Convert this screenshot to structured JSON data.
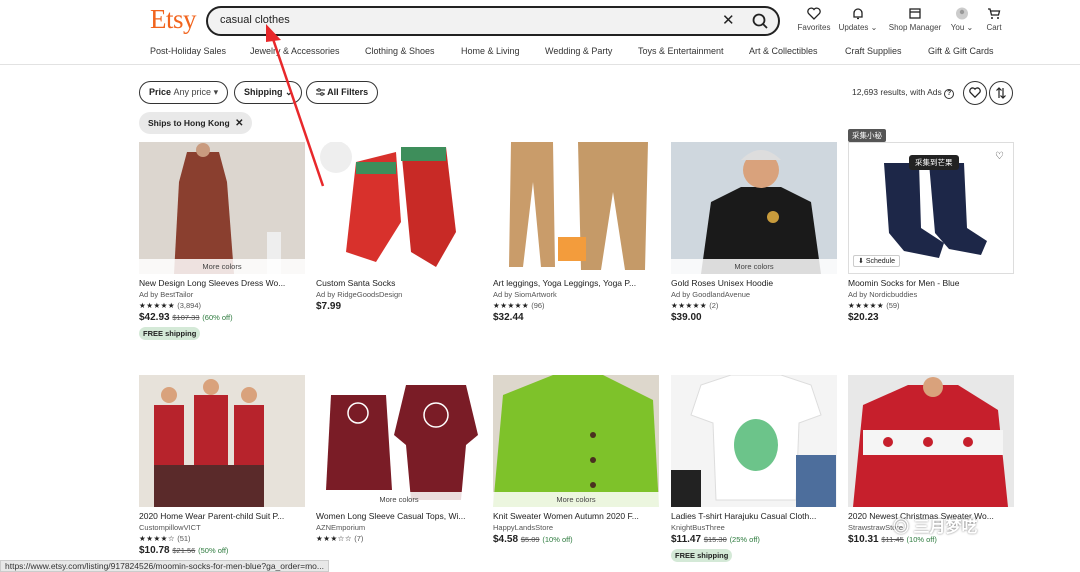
{
  "header": {
    "logo": "Etsy",
    "search_value": "casual clothes",
    "clear_glyph": "✕",
    "icons": [
      {
        "label": "Favorites",
        "icon": "heart-icon"
      },
      {
        "label": "Updates ⌄",
        "icon": "bell-icon"
      },
      {
        "label": "Shop Manager",
        "icon": "shop-icon"
      },
      {
        "label": "You ⌄",
        "icon": "avatar-icon"
      },
      {
        "label": "Cart",
        "icon": "cart-icon"
      }
    ]
  },
  "categories": [
    "Post-Holiday Sales",
    "Jewelry & Accessories",
    "Clothing & Shoes",
    "Home & Living",
    "Wedding & Party",
    "Toys & Entertainment",
    "Art & Collectibles",
    "Craft Supplies",
    "Gift & Gift Cards"
  ],
  "filters": {
    "price_label": "Price",
    "price_value": "Any price ▾",
    "shipping": "Shipping ⌄",
    "all_filters": "All Filters",
    "results": "12,693 results, with Ads",
    "chip": "Ships to Hong Kong"
  },
  "products": [
    {
      "title": "New Design Long Sleeves Dress Wo...",
      "ad": "Ad by BestTailor",
      "stars": "★★★★★",
      "reviews": "(3,894)",
      "price": "$42.93",
      "orig": "$107.33",
      "disc": "(60% off)",
      "ship": "FREE shipping",
      "colors": "More colors"
    },
    {
      "title": "Custom Santa Socks",
      "ad": "Ad by RidgeGoodsDesign",
      "stars": "",
      "reviews": "",
      "price": "$7.99",
      "orig": "",
      "disc": "",
      "ship": "",
      "colors": ""
    },
    {
      "title": "Art leggings, Yoga Leggings, Yoga P...",
      "ad": "Ad by SiomArtwork",
      "stars": "★★★★★",
      "reviews": "(96)",
      "price": "$32.44",
      "orig": "",
      "disc": "",
      "ship": "",
      "colors": ""
    },
    {
      "title": "Gold Roses Unisex Hoodie",
      "ad": "Ad by GoodlandAvenue",
      "stars": "★★★★★",
      "reviews": "(2)",
      "price": "$39.00",
      "orig": "",
      "disc": "",
      "ship": "",
      "colors": "More colors"
    },
    {
      "title": "Moomin Socks for Men - Blue",
      "ad": "Ad by Nordicbuddies",
      "stars": "★★★★★",
      "reviews": "(59)",
      "price": "$20.23",
      "orig": "",
      "disc": "",
      "ship": "",
      "colors": ""
    },
    {
      "title": "2020 Home Wear Parent-child Suit P...",
      "ad": "CustompillowVICT",
      "stars": "★★★★☆",
      "reviews": "(51)",
      "price": "$10.78",
      "orig": "$21.56",
      "disc": "(50% off)",
      "ship": "",
      "colors": ""
    },
    {
      "title": "Women Long Sleeve Casual Tops, Wi...",
      "ad": "AZNEmporium",
      "stars": "★★★☆☆",
      "reviews": "(7)",
      "price": "",
      "orig": "",
      "disc": "",
      "ship": "",
      "colors": "More colors"
    },
    {
      "title": "Knit Sweater Women Autumn 2020 F...",
      "ad": "HappyLandsStore",
      "stars": "",
      "reviews": "",
      "price": "$4.58",
      "orig": "$5.09",
      "disc": "(10% off)",
      "ship": "",
      "colors": "More colors"
    },
    {
      "title": "Ladies T-shirt Harajuku Casual Cloth...",
      "ad": "KnightBusThree",
      "stars": "",
      "reviews": "",
      "price": "$11.47",
      "orig": "$15.30",
      "disc": "(25% off)",
      "ship": "FREE shipping",
      "colors": ""
    },
    {
      "title": "2020 Newest Christmas Sweater Wo...",
      "ad": "StrawstrawStore",
      "stars": "",
      "reviews": "",
      "price": "$10.31",
      "orig": "$11.45",
      "disc": "(10% off)",
      "ship": "",
      "colors": ""
    }
  ],
  "overlay": {
    "badge": "采集小秘",
    "button": "采集到芒果",
    "schedule": "Schedule"
  },
  "status_url": "https://www.etsy.com/listing/917824526/moomin-socks-for-men-blue?ga_order=mo...",
  "watermark": "三月梦呓",
  "colors": {
    "brand": "#f1641e",
    "arrow": "#e8282b"
  }
}
